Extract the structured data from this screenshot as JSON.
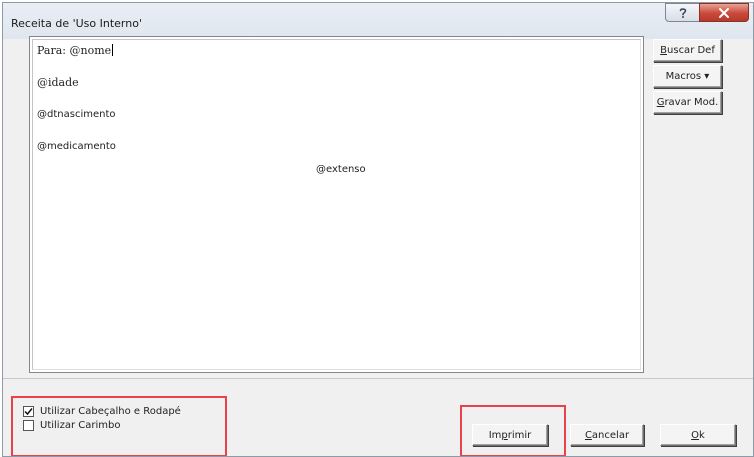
{
  "window": {
    "title": "Receita de 'Uso Interno'",
    "help_glyph": "?",
    "close_glyph": "x"
  },
  "editor": {
    "lines": [
      {
        "prefix": "Para: ",
        "text": "@nome"
      },
      {
        "text": "@idade"
      },
      {
        "text": "@dtnascimento"
      },
      {
        "text": "@medicamento"
      },
      {
        "text": "@extenso"
      }
    ]
  },
  "side_buttons": {
    "buscar_def": {
      "mnemonic": "B",
      "rest": "uscar Def"
    },
    "macros": {
      "label": "Macros ▾"
    },
    "gravar_mod": {
      "mnemonic": "G",
      "rest": "ravar Mod."
    }
  },
  "options": {
    "cabecalho": {
      "label": "Utilizar Cabeçalho e Rodapé",
      "checked": true
    },
    "carimbo": {
      "label": "Utilizar Carimbo",
      "checked": false
    }
  },
  "actions": {
    "imprimir": {
      "before": "Im",
      "mnemonic": "p",
      "after": "rimir"
    },
    "cancelar": {
      "mnemonic": "C",
      "rest": "ancelar"
    },
    "ok": {
      "mnemonic": "O",
      "rest": "k"
    }
  },
  "colors": {
    "highlight": "#e8434a",
    "close_button": "#c9493a",
    "dialog_bg": "#f0f0f0"
  }
}
